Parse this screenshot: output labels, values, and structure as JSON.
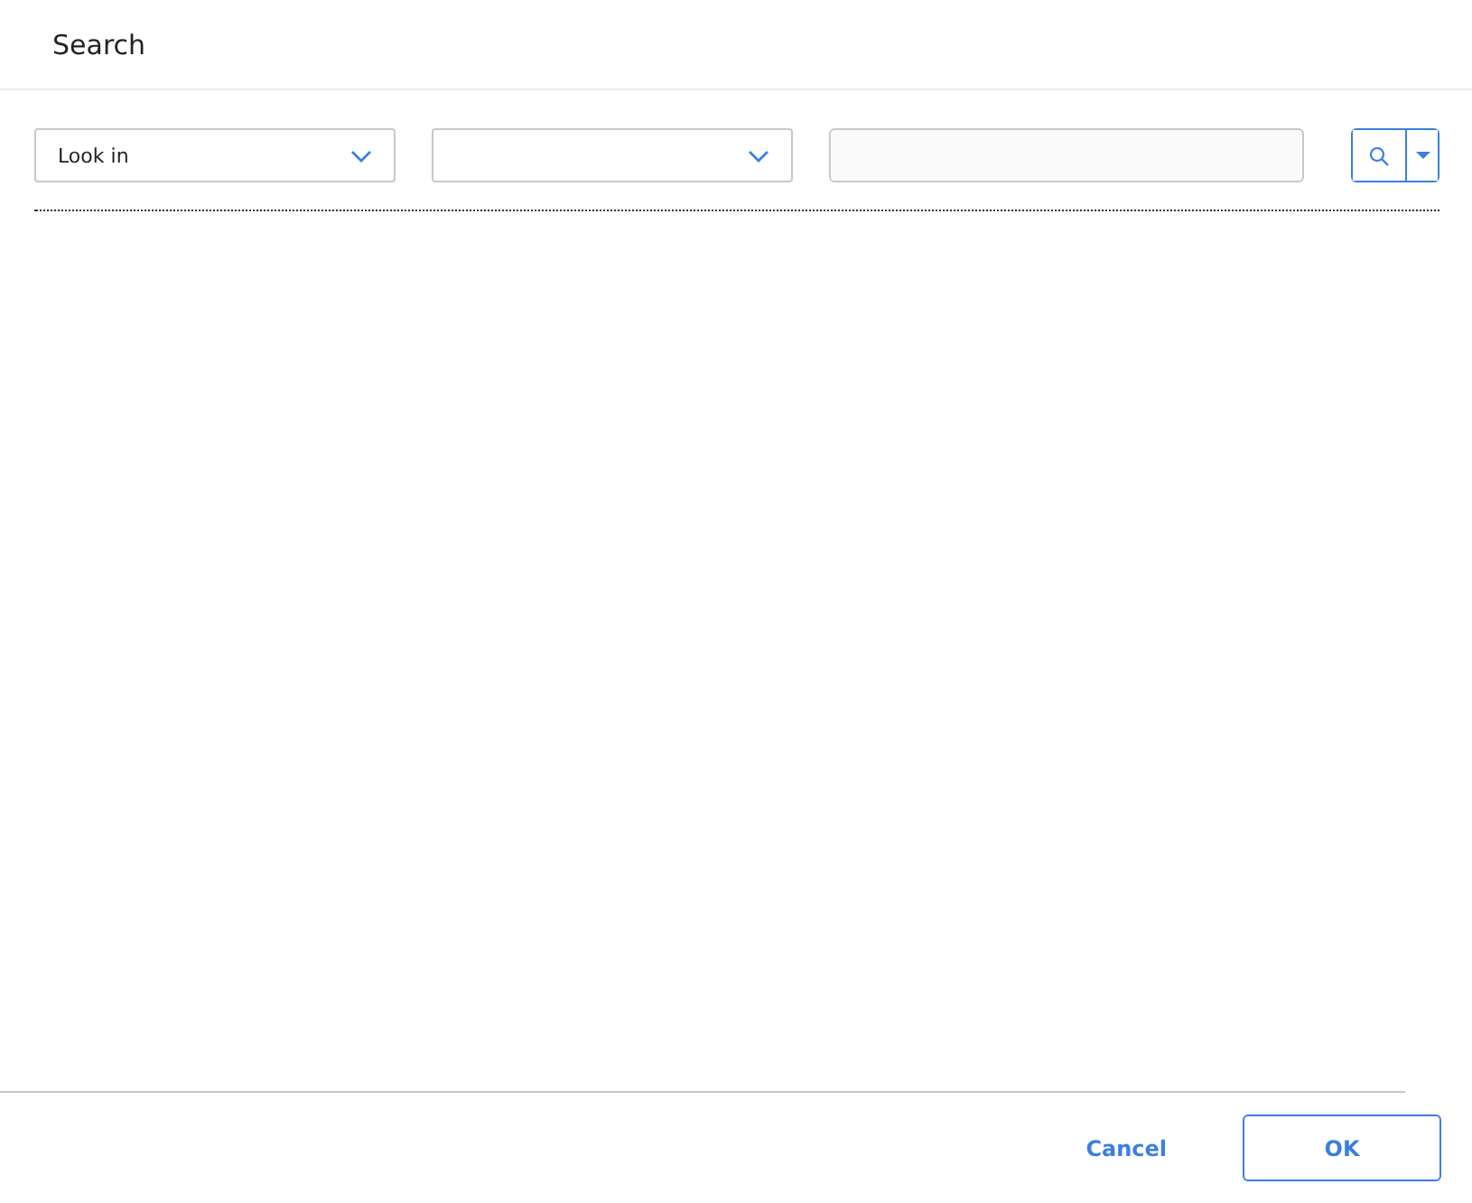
{
  "dialog": {
    "title": "Search"
  },
  "filters": [
    {
      "kind": "dropdown",
      "value": "Look in"
    },
    {
      "kind": "dropdown"
    },
    {
      "kind": "text"
    }
  ],
  "buttons": [
    {
      "kind": "link",
      "label": "Cancel"
    },
    {
      "kind": "outlined",
      "label": "OK"
    }
  ]
}
